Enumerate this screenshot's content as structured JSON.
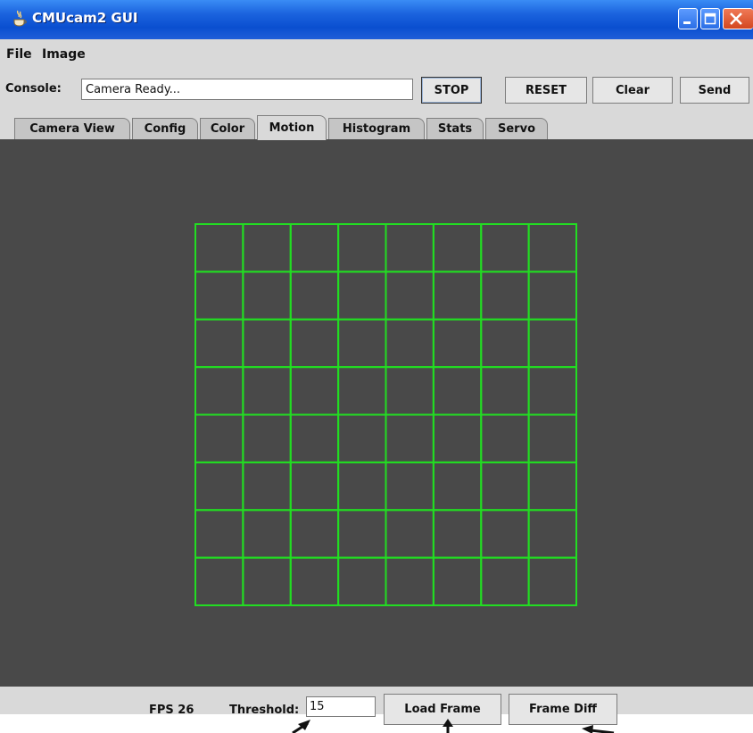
{
  "window": {
    "title": "CMUcam2 GUI"
  },
  "menu": {
    "items": [
      "File",
      "Image"
    ]
  },
  "console": {
    "label": "Console:",
    "value": "Camera Ready...",
    "buttons": {
      "stop": "STOP",
      "reset": "RESET",
      "clear": "Clear",
      "send": "Send"
    }
  },
  "tabs": [
    "Camera View",
    "Config",
    "Color",
    "Motion",
    "Histogram",
    "Stats",
    "Servo"
  ],
  "active_tab": "Motion",
  "motion_grid": {
    "rows": 8,
    "cols": 8,
    "line_color": "#22dd22",
    "background": "#494949"
  },
  "footer": {
    "fps_label": "FPS 26",
    "threshold_label": "Threshold:",
    "threshold_value": "15",
    "load_frame": "Load Frame",
    "frame_diff": "Frame Diff"
  },
  "colors": {
    "titlebar": "#0a4fd0",
    "window_bg": "#d9d9d9",
    "content_bg": "#494949",
    "grid": "#22dd22"
  }
}
